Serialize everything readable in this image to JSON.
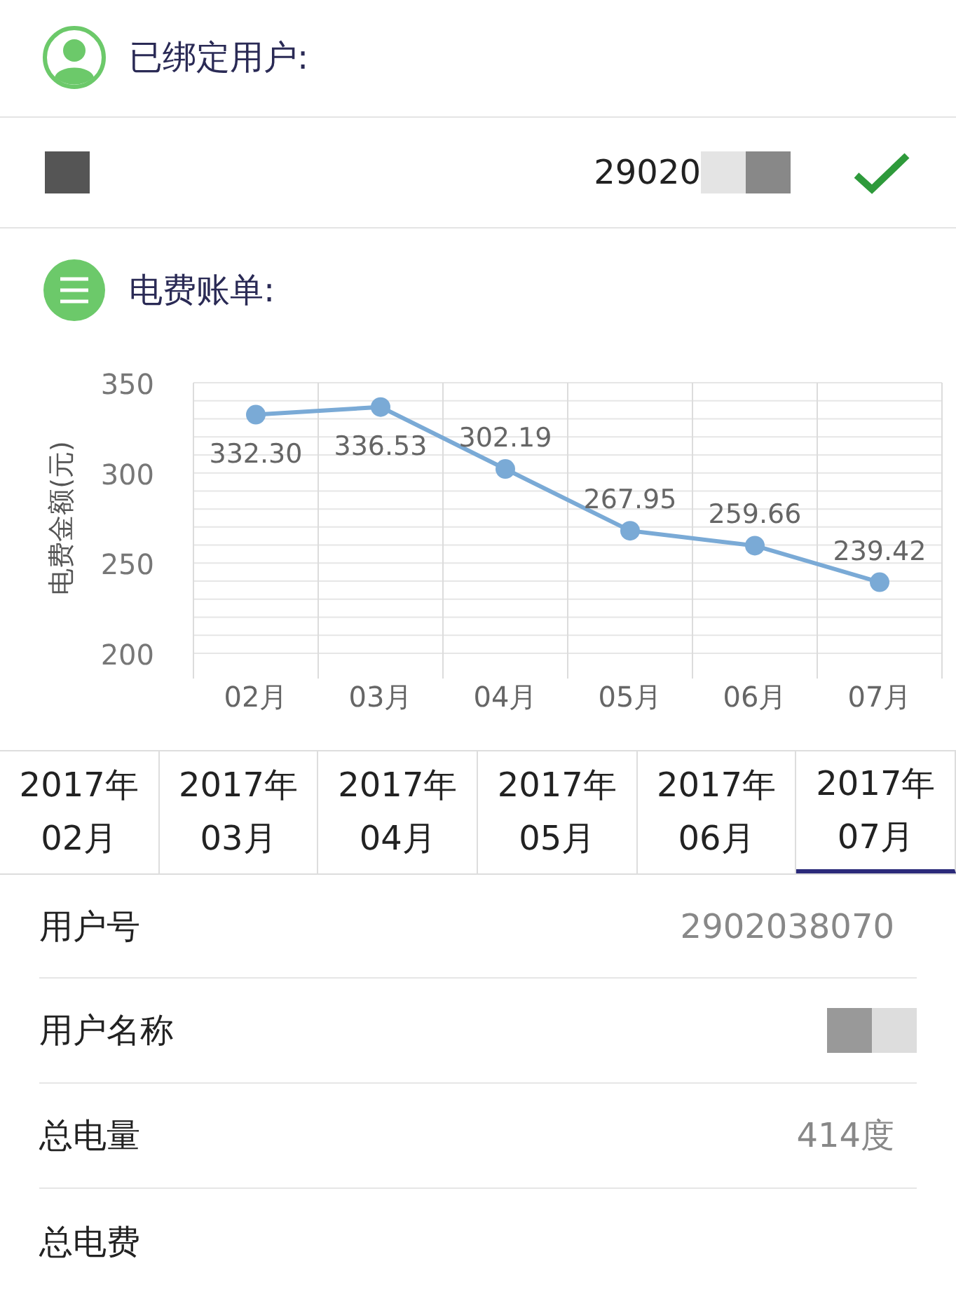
{
  "bound_user": {
    "title": "已绑定用户:",
    "account_partial": "29020",
    "checked": true
  },
  "bill": {
    "title": "电费账单:",
    "chart_data": {
      "type": "line",
      "ylabel": "电费金额(元)",
      "categories": [
        "02月",
        "03月",
        "04月",
        "05月",
        "06月",
        "07月"
      ],
      "series": [
        {
          "color": "#7aaad6",
          "marker": true,
          "values": [
            332.3,
            336.53,
            302.19,
            267.95,
            259.66,
            239.42
          ]
        }
      ],
      "ylim": [
        200,
        350
      ],
      "yticks": [
        200,
        250,
        300,
        350
      ],
      "value_labels": [
        "332.30",
        "336.53",
        "302.19",
        "267.95",
        "259.66",
        "239.42"
      ]
    }
  },
  "tabs": [
    {
      "year": "2017年",
      "month": "02月",
      "selected": false
    },
    {
      "year": "2017年",
      "month": "03月",
      "selected": false
    },
    {
      "year": "2017年",
      "month": "04月",
      "selected": false
    },
    {
      "year": "2017年",
      "month": "05月",
      "selected": false
    },
    {
      "year": "2017年",
      "month": "06月",
      "selected": false
    },
    {
      "year": "2017年",
      "month": "07月",
      "selected": true
    }
  ],
  "details": [
    {
      "label": "用户号",
      "value": "2902038070"
    },
    {
      "label": "用户名称",
      "kind": "redacted"
    },
    {
      "label": "总电量",
      "value": "414度"
    },
    {
      "label": "总电费",
      "kind": "empty"
    }
  ]
}
